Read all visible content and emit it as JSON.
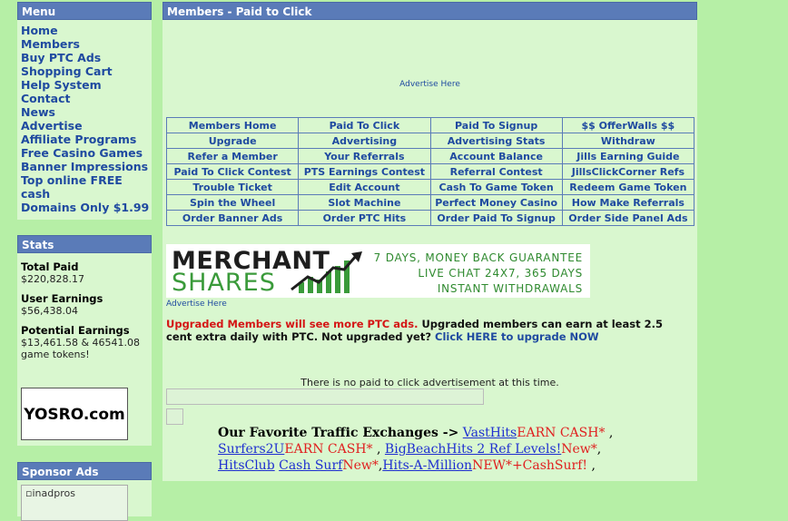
{
  "menu": {
    "title": "Menu",
    "items": [
      "Home",
      "Members",
      "Buy PTC Ads",
      "Shopping Cart",
      "Help System",
      "Contact",
      "News",
      "Advertise",
      "Affiliate Programs",
      "Free Casino Games",
      "Banner Impressions",
      "Top online FREE cash",
      "Domains Only $1.99"
    ]
  },
  "stats": {
    "title": "Stats",
    "total_paid_label": "Total Paid",
    "total_paid_value": "$220,828.17",
    "user_earnings_label": "User Earnings",
    "user_earnings_value": "$56,438.04",
    "potential_label": "Potential Earnings",
    "potential_value": "$13,461.58 & 46541.08 game tokens!",
    "logo_text": "YOSRO.com"
  },
  "sponsor": {
    "title": "Sponsor Ads",
    "image_alt": "inadpros"
  },
  "main": {
    "title": "Members - Paid to Click",
    "advertise_here_top": "Advertise Here",
    "advertise_here_below": "Advertise Here",
    "nav_rows": [
      [
        "Members Home",
        "Paid To Click",
        "Paid To Signup",
        "$$ OfferWalls $$"
      ],
      [
        "Upgrade",
        "Advertising",
        "Advertising Stats",
        "Withdraw"
      ],
      [
        "Refer a Member",
        "Your Referrals",
        "Account Balance",
        "Jills Earning Guide"
      ],
      [
        "Paid To Click Contest",
        "PTS Earnings Contest",
        "Referral Contest",
        "JillsClickCorner Refs"
      ],
      [
        "Trouble Ticket",
        "Edit Account",
        "Cash To Game Token",
        "Redeem Game Token"
      ],
      [
        "Spin the Wheel",
        "Slot Machine",
        "Perfect Money Casino",
        "How Make Referrals"
      ],
      [
        "Order Banner Ads",
        "Order PTC Hits",
        "Order Paid To Signup",
        "Order Side Panel Ads"
      ]
    ],
    "banner": {
      "brand_top": "MERCHANT",
      "brand_bottom": "SHARES",
      "line1": "7 DAYS, MONEY BACK GUARANTEE",
      "line2": "LIVE CHAT 24X7, 365 DAYS",
      "line3": "INSTANT WITHDRAWALS"
    },
    "upgrade": {
      "red_text": "Upgraded Members will see more PTC ads.",
      "dark_text": " Upgraded members can earn at least 2.5 cent extra daily with PTC. Not upgraded yet? ",
      "link_text": "Click HERE to upgrade NOW"
    },
    "no_ads_message": "There is no paid to click advertisement at this time.",
    "traffic": {
      "title": "Our Favorite Traffic Exchanges ->",
      "link1": "VastHits",
      "red1": "EARN CASH*",
      "sep1": " ,",
      "link2": "Surfers2U",
      "red2": "EARN CASH*",
      "sep2": " , ",
      "link3": "BigBeachHits 2 Ref Levels!",
      "red3": "New*",
      "sep3": ", ",
      "link4": "HitsClub",
      "link5": "Cash Surf",
      "red5": "New*",
      "sep5": ",",
      "link6": "Hits-A-Million",
      "red6": "NEW*+CashSurf!",
      "sep6": " ,"
    }
  },
  "colors": {
    "page_bg": "#b6efa6",
    "panel_bg": "#d9f7cf",
    "header_bg": "#5a7bb8",
    "link_blue": "#1f4aa0",
    "alert_red": "#d41515"
  }
}
